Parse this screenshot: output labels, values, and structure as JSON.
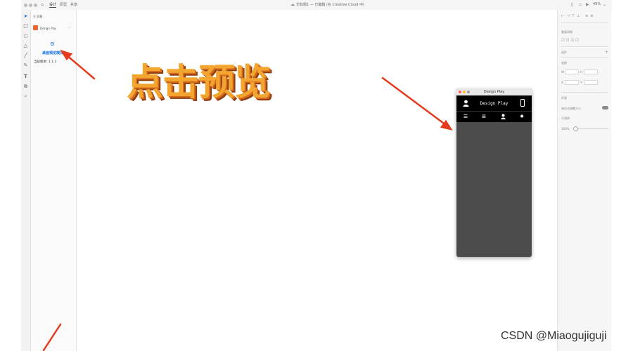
{
  "topbar": {
    "tabs": [
      "设计",
      "原型",
      "共享"
    ],
    "document_title": "无标题1 — 已编辑 (在 Creative Cloud 中)",
    "zoom": "49%"
  },
  "left_panel": {
    "header": "主 屏幕",
    "artboard_name": "Design Play",
    "link_icon": "link-icon",
    "share_link_label": "桌面预览模式",
    "version_label": "当前版本: 1.1.3"
  },
  "right_panel": {
    "section_repeat_grid": "重复网格",
    "section_component": "组件",
    "section_transform": "变换",
    "field_w": "W",
    "field_h": "H",
    "field_x": "X",
    "field_y": "Y",
    "section_appearance": "外观",
    "appearance_responsive": "响应式调整大小",
    "section_opacity": "不透明",
    "opacity_value": "100%"
  },
  "headline": "点击预览",
  "preview": {
    "window_title": "Design Play",
    "app_title": "Design Play",
    "header_left_icon": "user-icon",
    "header_right_icon": "phone-icon",
    "nav_icons": [
      "menu-icon",
      "gift-icon",
      "user-icon",
      "settings-icon"
    ]
  },
  "annotations": {
    "arrow_color": "#e53a1e"
  },
  "watermark": "CSDN @Miaogujiguji"
}
